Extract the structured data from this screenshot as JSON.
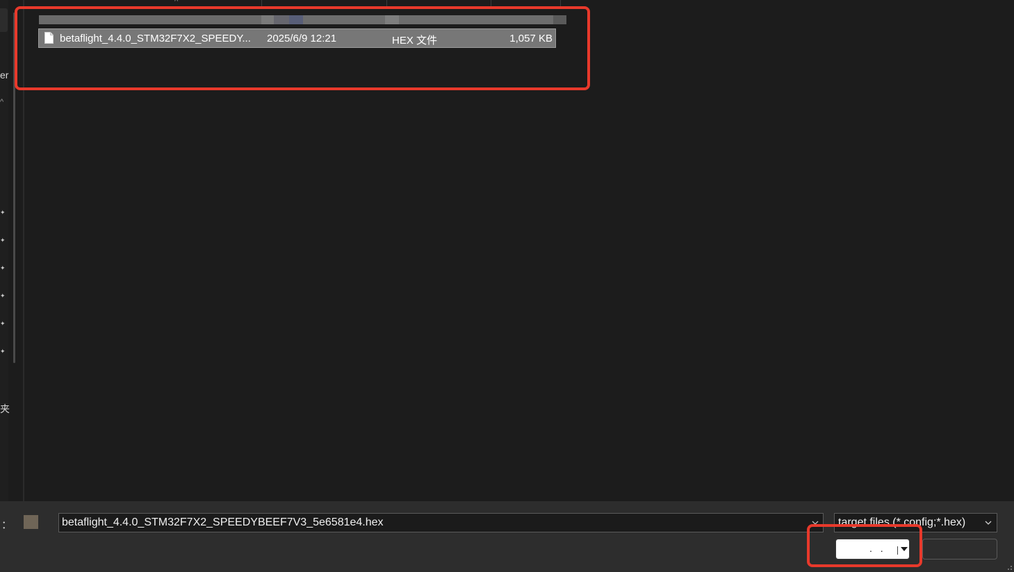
{
  "nav": {
    "partial_label_top": "er",
    "partial_label_bottom": "夹",
    "collapse_icon": "chevron-up-icon",
    "pinned_items_icon": "pin-icon",
    "pinned_count": 6
  },
  "file_list": {
    "sort_icon": "chevron-up-icon",
    "files": [
      {
        "name": "betaflight_4.4.0_STM32F7X2_SPEEDY...",
        "date_modified": "2025/6/9 12:21",
        "type": "HEX 文件",
        "size": "1,057 KB",
        "icon": "document-icon",
        "selected": true
      }
    ]
  },
  "bottom_bar": {
    "filename_label": "：",
    "filename_value": "betaflight_4.4.0_STM32F7X2_SPEEDYBEEF7V3_5e6581e4.hex",
    "filter_value": "target files (*.config;*.hex)",
    "open_button_label": ". .",
    "cancel_button_label": ""
  },
  "colors": {
    "highlight": "#e8392b",
    "selected_row": "#777777",
    "background": "#1c1c1c",
    "bottom_bar": "#2d2d2d"
  }
}
